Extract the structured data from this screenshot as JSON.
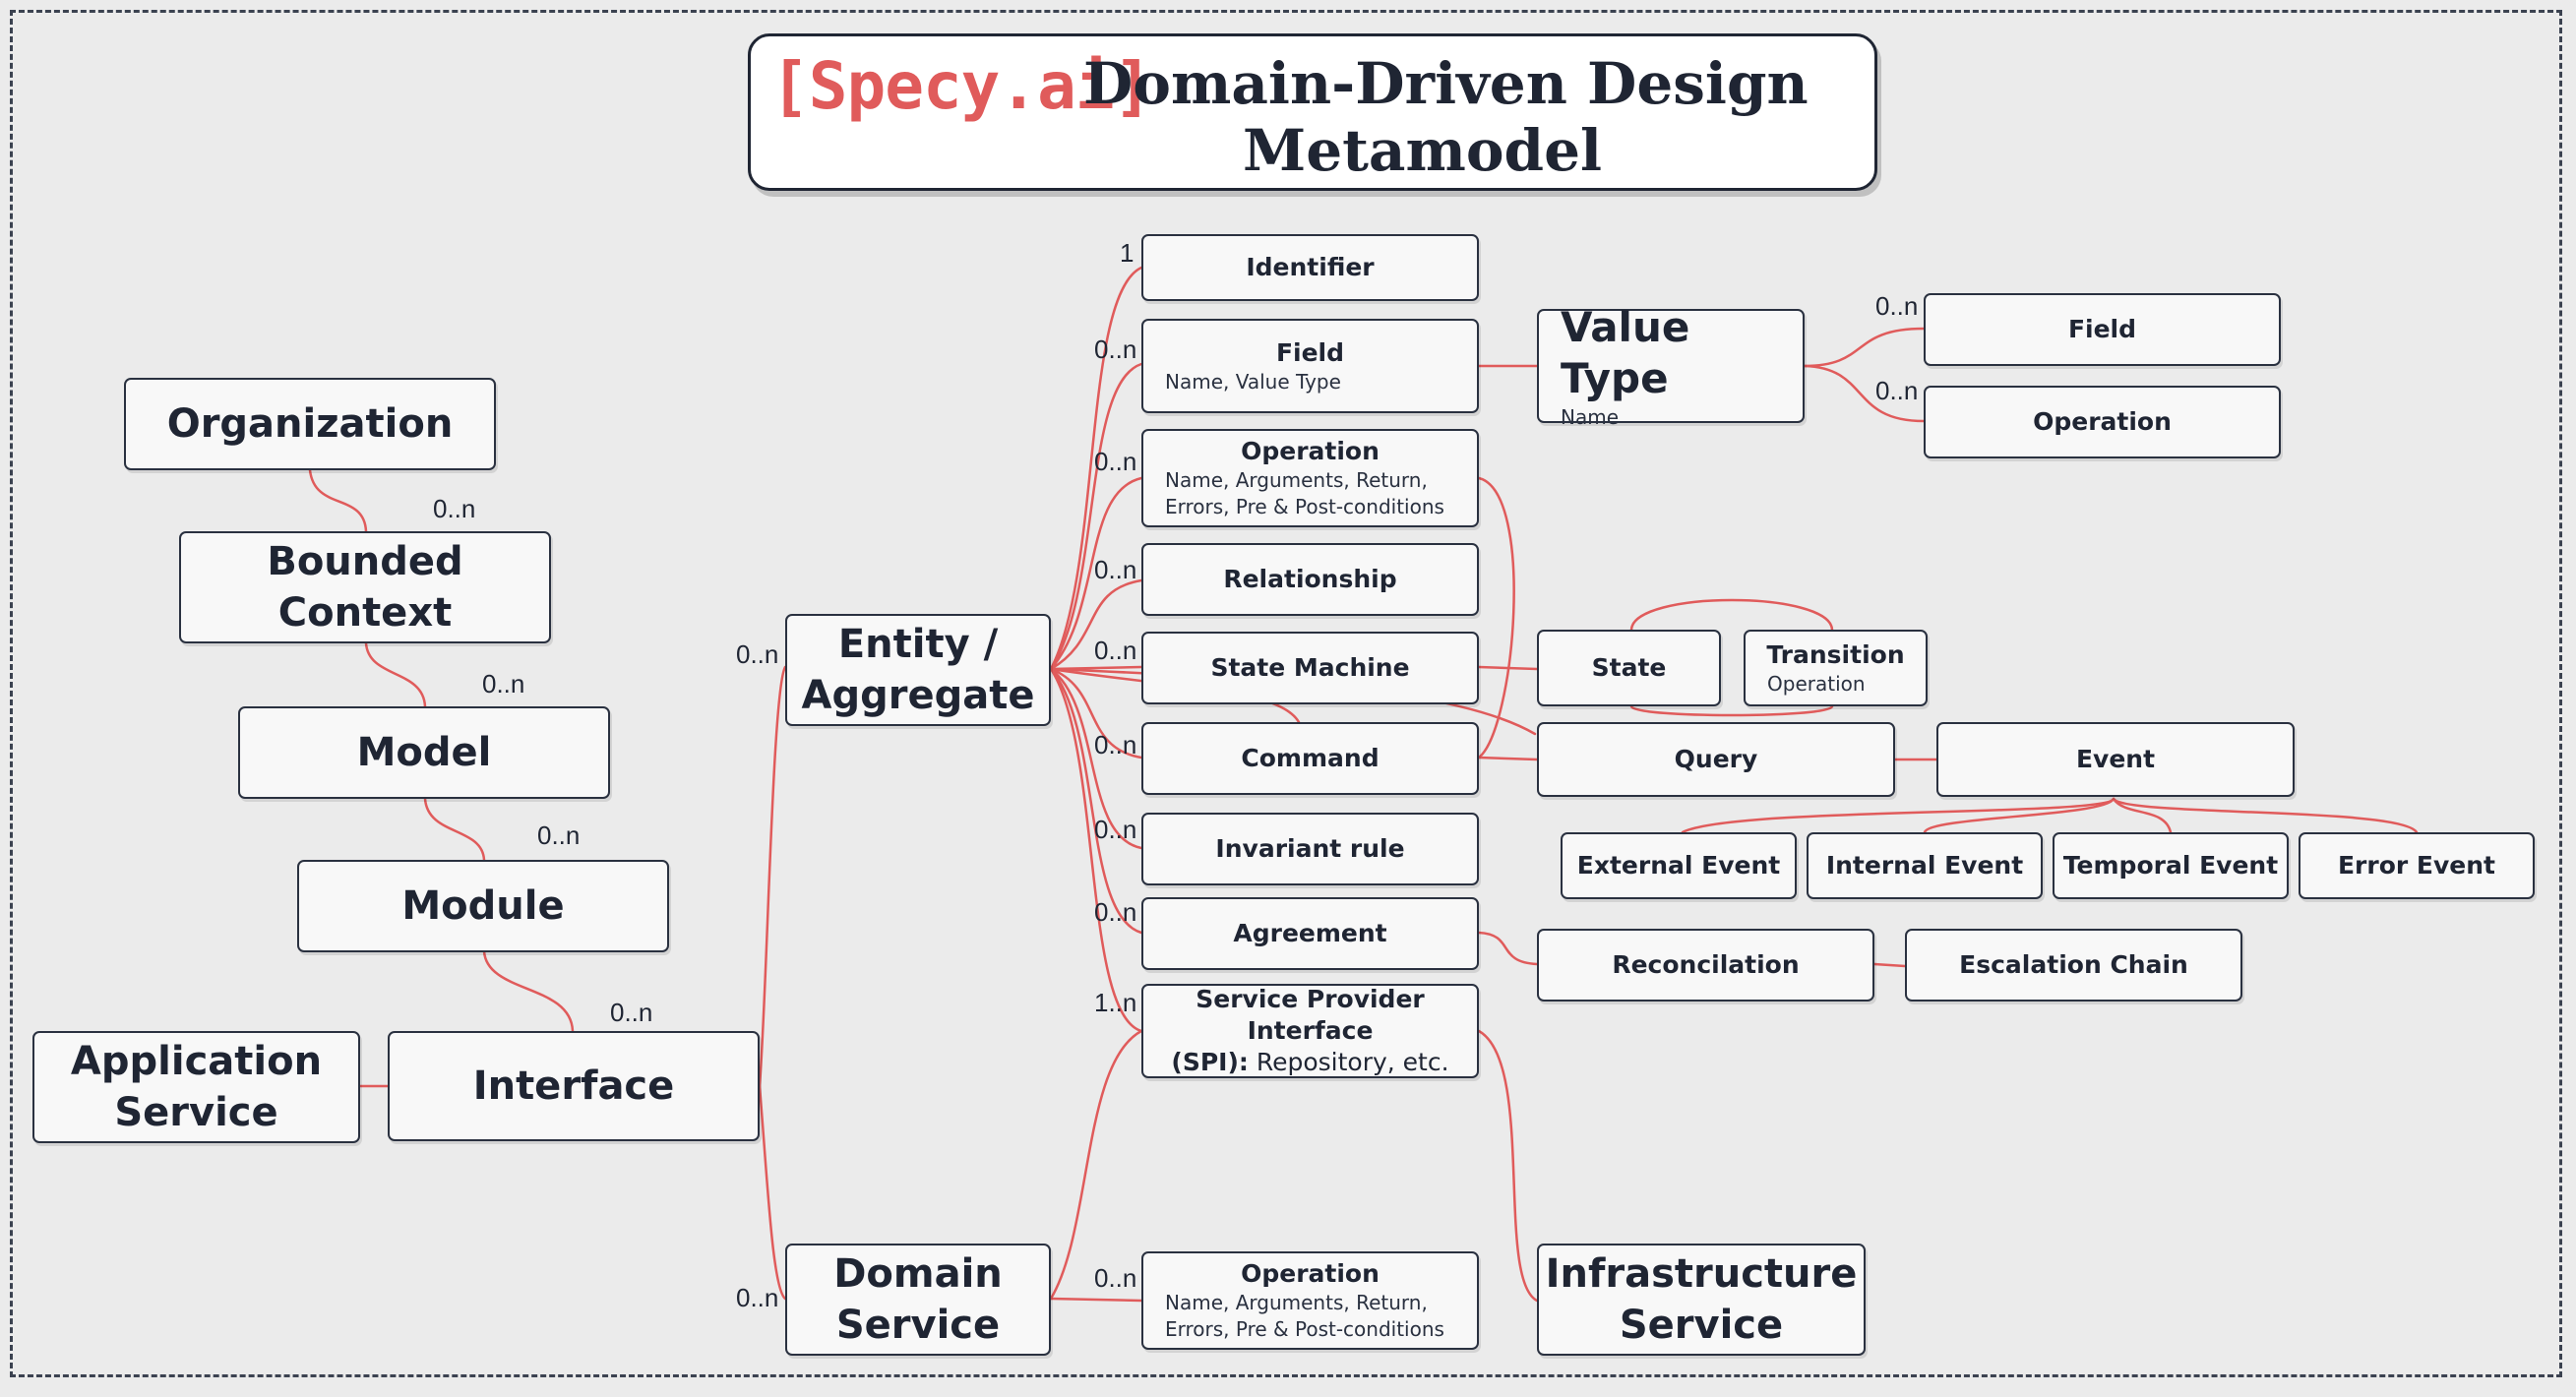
{
  "title": {
    "logo": "[Specy.ai]",
    "line1": "Domain-Driven Design",
    "line2": "Metamodel"
  },
  "nodes": {
    "organization": "Organization",
    "bounded_context": "Bounded Context",
    "model": "Model",
    "module": "Module",
    "interface": "Interface",
    "application_service": "Application Service",
    "entity_aggregate": "Entity / Aggregate",
    "domain_service": "Domain Service",
    "identifier": "Identifier",
    "field": {
      "title": "Field",
      "sub": "Name, Value Type"
    },
    "operation": {
      "title": "Operation",
      "sub1": "Name, Arguments, Return,",
      "sub2": "Errors, Pre & Post-conditions"
    },
    "relationship": "Relationship",
    "state_machine": "State Machine",
    "command": "Command",
    "invariant_rule": "Invariant rule",
    "agreement": "Agreement",
    "spi": {
      "line1": "Service Provider Interface",
      "line2_bold": "(SPI):",
      "line2_rest": " Repository, etc."
    },
    "ds_operation": {
      "title": "Operation",
      "sub1": "Name, Arguments, Return,",
      "sub2": "Errors, Pre & Post-conditions"
    },
    "value_type": {
      "title": "Value Type",
      "sub": "Name"
    },
    "vt_field": "Field",
    "vt_operation": "Operation",
    "state": "State",
    "transition": {
      "title": "Transition",
      "sub": "Operation"
    },
    "query": "Query",
    "event": "Event",
    "external_event": "External Event",
    "internal_event": "Internal Event",
    "temporal_event": "Temporal Event",
    "error_event": "Error Event",
    "reconciliation": "Reconcilation",
    "escalation_chain": "Escalation Chain",
    "infrastructure_service": "Infrastructure Service"
  },
  "cardinality": {
    "org_bc": "0..n",
    "bc_model": "0..n",
    "model_module": "0..n",
    "module_interface": "0..n",
    "interface_entity": "0..n",
    "interface_domain_service": "0..n",
    "identifier": "1",
    "field": "0..n",
    "operation": "0..n",
    "relationship": "0..n",
    "state_machine": "0..n",
    "command": "0..n",
    "invariant_rule": "0..n",
    "agreement": "0..n",
    "spi": "1..n",
    "ds_operation": "0..n",
    "vt_field": "0..n",
    "vt_operation": "0..n"
  },
  "colors": {
    "link": "#e05b5b",
    "border": "#2a3140",
    "text": "#1f2533",
    "background": "#ebebeb"
  }
}
